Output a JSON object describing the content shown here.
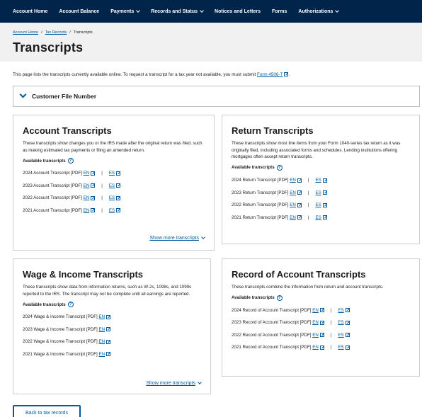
{
  "nav": {
    "items": [
      {
        "label": "Account Home",
        "dropdown": false
      },
      {
        "label": "Account Balance",
        "dropdown": false
      },
      {
        "label": "Payments",
        "dropdown": true
      },
      {
        "label": "Records and Status",
        "dropdown": true
      },
      {
        "label": "Notices and Letters",
        "dropdown": false
      },
      {
        "label": "Forms",
        "dropdown": false
      },
      {
        "label": "Authorizations",
        "dropdown": true
      }
    ]
  },
  "breadcrumb": {
    "items": [
      "Account Home",
      "Tax Records",
      "Transcripts"
    ],
    "separator": "/"
  },
  "page": {
    "title": "Transcripts",
    "intro_text": "This page lists the transcripts currently available online. To request a transcript for a tax year not available, you must submit ",
    "intro_link": "Form 4506-T",
    "intro_end": "."
  },
  "accordion": {
    "label": "Customer File Number"
  },
  "cards": {
    "account": {
      "title": "Account Transcripts",
      "description": "These transcripts show changes you or the IRS made after the original return was filed, such as making estimated tax payments or filing an amended return.",
      "available_label": "Available transcripts",
      "help_glyph": "?",
      "rows": [
        {
          "label": "2024 Account Transcript [PDF]",
          "en": "EN",
          "es": "ES"
        },
        {
          "label": "2023 Account Transcript [PDF]",
          "en": "EN",
          "es": "ES"
        },
        {
          "label": "2022 Account Transcript [PDF]",
          "en": "EN",
          "es": "ES"
        },
        {
          "label": "2021 Account Transcript [PDF]",
          "en": "EN",
          "es": "ES"
        }
      ],
      "show_more": "Show more transcripts"
    },
    "return": {
      "title": "Return Transcripts",
      "description": "These transcripts show most line items from your Form 1040-series tax return as it was originally filed, including associated forms and schedules. Lending institutions offering mortgages often accept return transcripts.",
      "available_label": "Available transcripts",
      "help_glyph": "?",
      "rows": [
        {
          "label": "2024 Return Transcript [PDF]",
          "en": "EN",
          "es": "ES"
        },
        {
          "label": "2023 Return Transcript [PDF]",
          "en": "EN",
          "es": "ES"
        },
        {
          "label": "2022 Return Transcript [PDF]",
          "en": "EN",
          "es": "ES"
        },
        {
          "label": "2021 Return Transcript [PDF]",
          "en": "EN",
          "es": "ES"
        }
      ]
    },
    "wage": {
      "title": "Wage & Income Transcripts",
      "description": "These transcripts show data from information returns, such as W-2s, 1098s, and 1099s reported to the IRS. The transcript may not be complete until all earnings are reported.",
      "available_label": "Available transcripts",
      "help_glyph": "?",
      "rows": [
        {
          "label": "2024 Wage & Income Transcript [PDF]",
          "en": "EN"
        },
        {
          "label": "2023 Wage & Income Transcript [PDF]",
          "en": "EN"
        },
        {
          "label": "2022 Wage & Income Transcript [PDF]",
          "en": "EN"
        },
        {
          "label": "2021 Wage & Income Transcript [PDF]",
          "en": "EN"
        }
      ],
      "show_more": "Show more transcripts"
    },
    "record": {
      "title": "Record of Account Transcripts",
      "description": "These transcripts combine the information from return and account transcripts.",
      "available_label": "Available transcripts",
      "help_glyph": "?",
      "rows": [
        {
          "label": "2024 Record of Account Transcript [PDF]",
          "en": "EN",
          "es": "ES"
        },
        {
          "label": "2023 Record of Account Transcript [PDF]",
          "en": "EN",
          "es": "ES"
        },
        {
          "label": "2022 Record of Account Transcript [PDF]",
          "en": "EN",
          "es": "ES"
        },
        {
          "label": "2021 Record of Account Transcript [PDF]",
          "en": "EN",
          "es": "ES"
        }
      ]
    }
  },
  "back_button": {
    "label": "Back to tax records"
  },
  "colors": {
    "nav_bg": "#00244a",
    "link": "#00599c",
    "header_band": "#f1f1f1",
    "card_border": "#cfcfcf"
  }
}
